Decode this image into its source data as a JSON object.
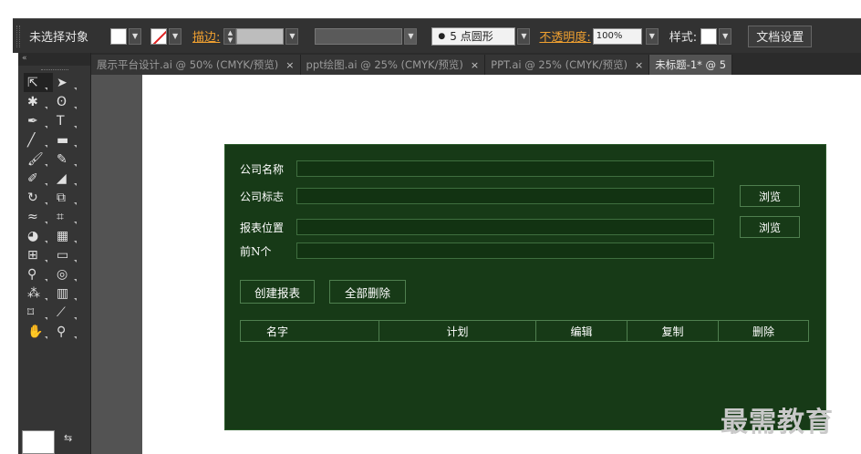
{
  "control_bar": {
    "selection_status": "未选择对象",
    "stroke_label": "描边:",
    "brush_label": "5 点圆形",
    "opacity_label": "不透明度:",
    "opacity_value": "100%",
    "style_label": "样式:",
    "doc_settings_label": "文档设置"
  },
  "colors": {
    "accent_orange": "#f0a030",
    "form_panel_bg": "#173a17",
    "ui_dark": "#323232",
    "stroke_none_red": "#e02020"
  },
  "tabs": [
    {
      "label": "展示平台设计.ai @ 50% (CMYK/预览)",
      "close": "×",
      "active": false
    },
    {
      "label": "ppt绘图.ai @ 25% (CMYK/预览)",
      "close": "×",
      "active": false
    },
    {
      "label": "PPT.ai @ 25% (CMYK/预览)",
      "close": "×",
      "active": false
    },
    {
      "label": "未标题-1* @ 5",
      "close": "",
      "active": true
    }
  ],
  "tools_panel": {
    "collapse_glyph": "«",
    "tools": [
      [
        "selection-tool-icon",
        "direct-selection-tool-icon"
      ],
      [
        "magic-wand-tool-icon",
        "lasso-tool-icon"
      ],
      [
        "pen-tool-icon",
        "type-tool-icon"
      ],
      [
        "line-segment-tool-icon",
        "rectangle-tool-icon"
      ],
      [
        "paintbrush-tool-icon",
        "pencil-tool-icon"
      ],
      [
        "blob-brush-tool-icon",
        "eraser-tool-icon"
      ],
      [
        "rotate-tool-icon",
        "scale-tool-icon"
      ],
      [
        "width-tool-icon",
        "free-transform-tool-icon"
      ],
      [
        "shape-builder-tool-icon",
        "perspective-grid-tool-icon"
      ],
      [
        "mesh-tool-icon",
        "gradient-tool-icon"
      ],
      [
        "eyedropper-tool-icon",
        "blend-tool-icon"
      ],
      [
        "symbol-sprayer-tool-icon",
        "column-graph-tool-icon"
      ],
      [
        "artboard-tool-icon",
        "slice-tool-icon"
      ],
      [
        "hand-tool-icon",
        "zoom-tool-icon"
      ]
    ]
  },
  "form": {
    "company_name_label": "公司名称",
    "company_logo_label": "公司标志",
    "report_location_label": "报表位置",
    "top_n_label": "前N个",
    "browse_label_1": "浏览",
    "browse_label_2": "浏览",
    "create_report_label": "创建报表",
    "delete_all_label": "全部删除",
    "columns": [
      "名字",
      "计划",
      "编辑",
      "复制",
      "删除"
    ]
  },
  "watermark": "最需教育"
}
